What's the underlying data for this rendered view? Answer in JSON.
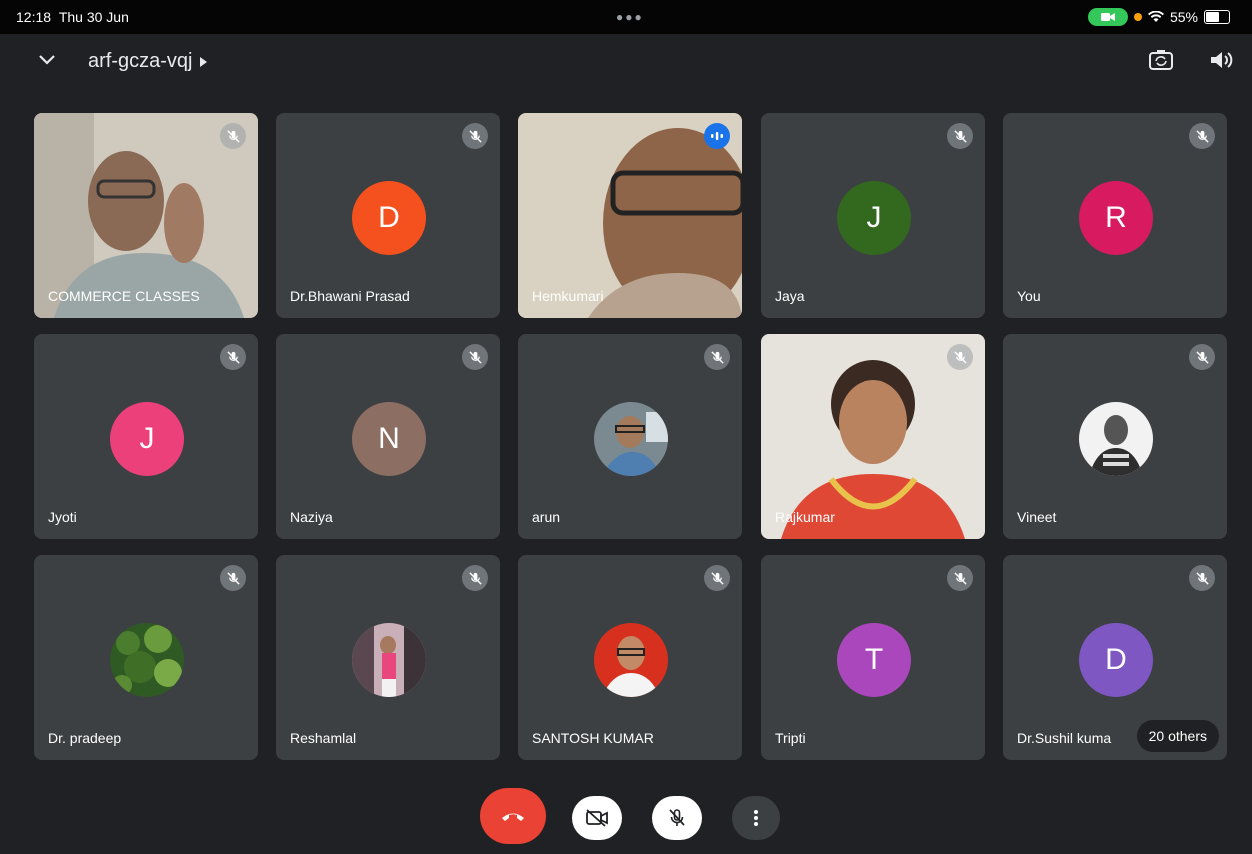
{
  "status_bar": {
    "time": "12:18",
    "date": "Thu 30 Jun",
    "battery": "55%",
    "battery_level": 0.55
  },
  "meeting": {
    "code": "arf-gcza-vqj"
  },
  "participants": [
    {
      "name": "COMMERCE CLASSES",
      "type": "video",
      "muted": true
    },
    {
      "name": "Dr.Bhawani Prasad",
      "type": "initial",
      "initial": "D",
      "color": "#f4511e",
      "muted": true
    },
    {
      "name": "Hemkumari",
      "type": "video",
      "speaking": true
    },
    {
      "name": "Jaya",
      "type": "initial",
      "initial": "J",
      "color": "#33691e",
      "muted": true
    },
    {
      "name": "You",
      "type": "initial",
      "initial": "R",
      "color": "#d81b60",
      "muted": true
    },
    {
      "name": "Jyoti",
      "type": "initial",
      "initial": "J",
      "color": "#ec407a",
      "muted": true
    },
    {
      "name": "Naziya",
      "type": "initial",
      "initial": "N",
      "color": "#8d6e63",
      "muted": true
    },
    {
      "name": "arun",
      "type": "photo",
      "muted": true
    },
    {
      "name": "Rajkumar",
      "type": "video",
      "muted": true
    },
    {
      "name": "Vineet",
      "type": "photo",
      "muted": true
    },
    {
      "name": "Dr. pradeep",
      "type": "photo",
      "muted": true
    },
    {
      "name": "Reshamlal",
      "type": "photo",
      "muted": true
    },
    {
      "name": "SANTOSH KUMAR",
      "type": "photo",
      "muted": true
    },
    {
      "name": "Tripti",
      "type": "initial",
      "initial": "T",
      "color": "#ab47bc",
      "muted": true
    },
    {
      "name": "Dr.Sushil kuma",
      "type": "initial",
      "initial": "D",
      "color": "#7e57c2",
      "muted": true
    }
  ],
  "others_label": "20 others",
  "controls": {
    "end_call_color": "#ea4335",
    "icons": [
      "end-call-icon",
      "camera-off-icon",
      "mic-off-icon",
      "more-vert-icon"
    ]
  }
}
